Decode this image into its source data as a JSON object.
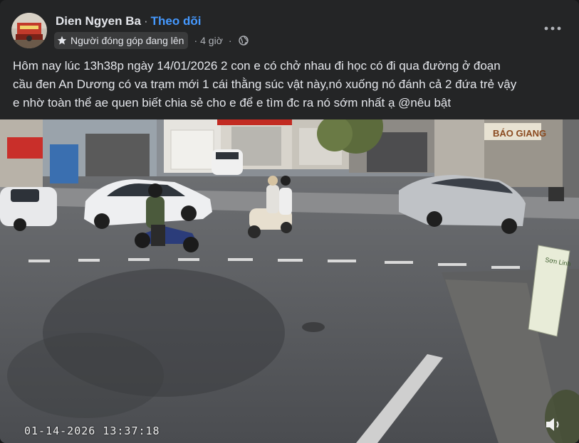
{
  "post": {
    "author": "Dien Ngyen Ba",
    "separator": "·",
    "follow_label": "Theo dõi",
    "badge_label": "Người đóng góp đang lên",
    "time": "4 giờ",
    "meta_separator": "·",
    "text_lines": [
      "Hôm nay lúc 13h38p ngày 14/01/2026 2  con e có chở nhau đi học có đi qua đường ở đoạn",
      "cầu đen An Dương có va trạm mới 1 cái thằng súc vật này,nó xuống nó đánh cả 2 đứa trẻ vậy",
      "e nhờ toàn thể ae quen biết chia sẻ cho e để e tìm đc ra nó sớm nhất ạ @nêu bật"
    ]
  },
  "video": {
    "timestamp": "01-14-2026 13:37:18",
    "sign_store_text": "BÁO GIANG",
    "sign_side_text": "Sơn Linh"
  },
  "icons": {
    "badge": "star-badge-icon",
    "privacy": "globe-icon",
    "menu": "more-options-icon",
    "audio": "volume-icon"
  },
  "colors": {
    "background": "#242526",
    "text": "#e4e6eb",
    "secondary_text": "#b0b3b8",
    "follow": "#4599ff"
  }
}
